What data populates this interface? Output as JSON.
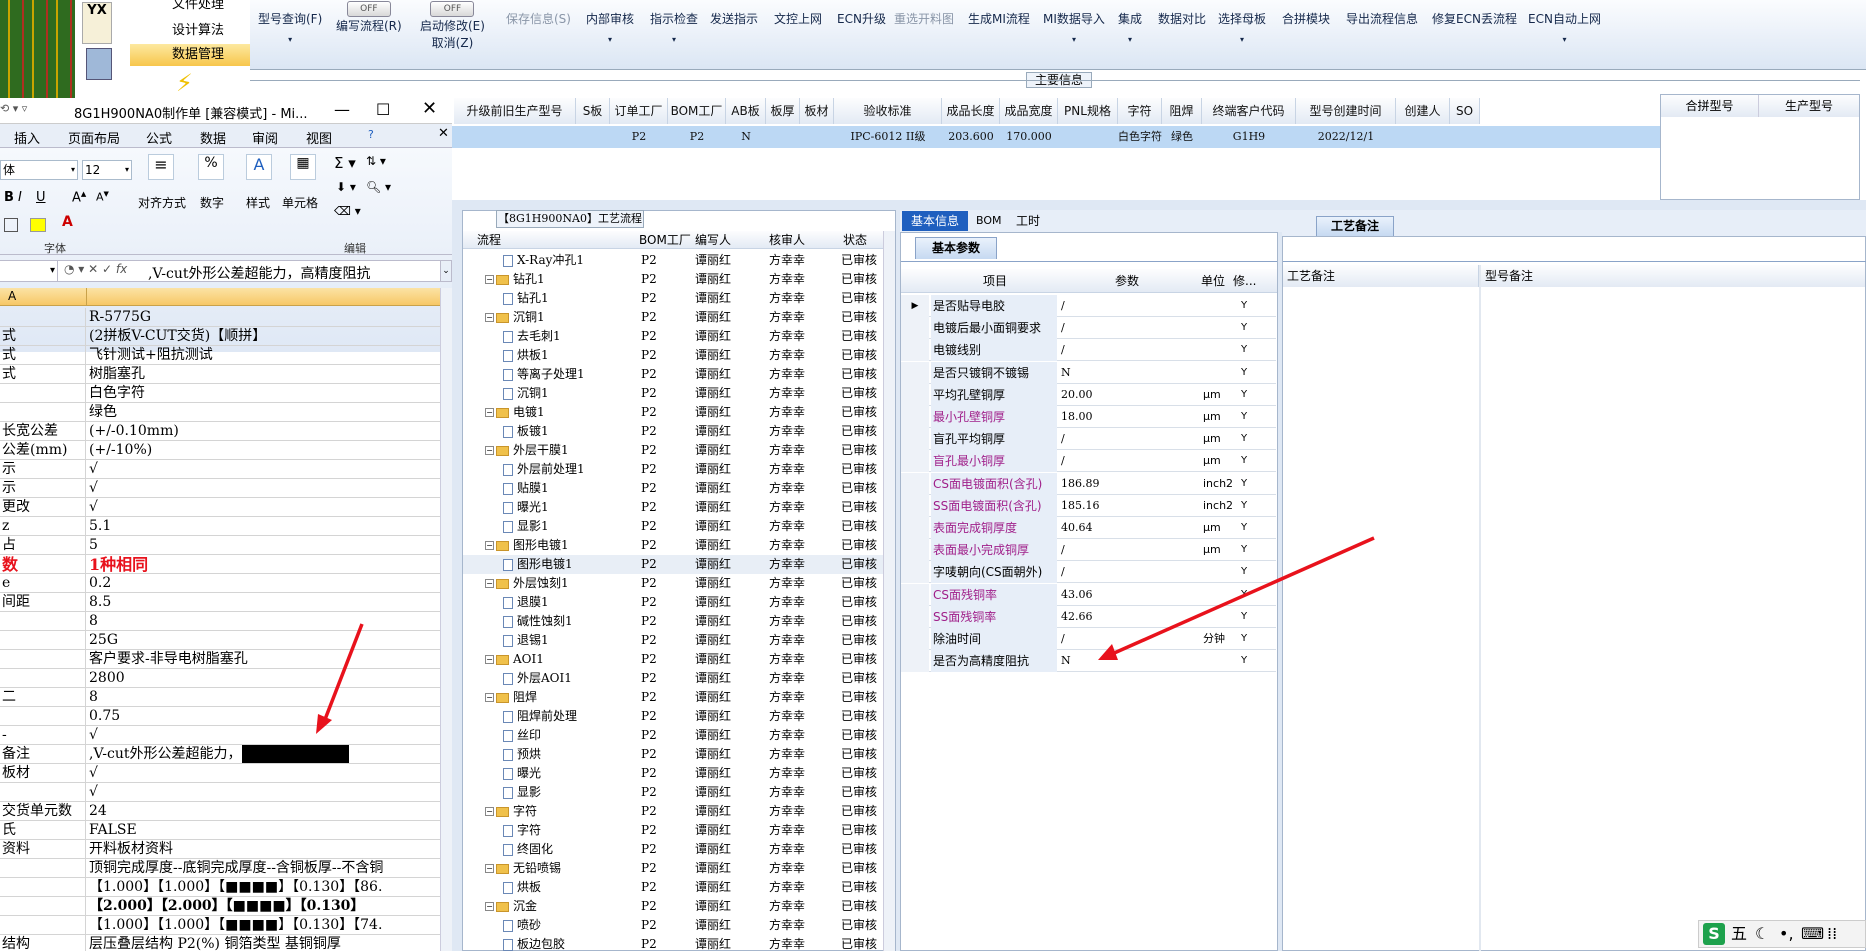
{
  "nav": {
    "items": [
      "文件处理",
      "设计算法",
      "数据管理"
    ],
    "logo": "YX"
  },
  "toolbar": {
    "items": [
      {
        "label": "型号查询(F)",
        "enabled": true
      },
      {
        "label": "编写流程(R)",
        "enabled": true
      },
      {
        "label": "启动修改(E)",
        "enabled": true
      },
      {
        "label": "取消(Z)",
        "enabled": true
      },
      {
        "label": "保存信息(S)",
        "enabled": false
      },
      {
        "label": "内部审核",
        "enabled": true
      },
      {
        "label": "指示检查",
        "enabled": true
      },
      {
        "label": "发送指示",
        "enabled": true
      },
      {
        "label": "文控上网",
        "enabled": true
      },
      {
        "label": "ECN升级",
        "enabled": true
      },
      {
        "label": "重选开料图",
        "enabled": false
      },
      {
        "label": "生成MI流程",
        "enabled": true
      },
      {
        "label": "MI数据导入",
        "enabled": true
      },
      {
        "label": "集成",
        "enabled": true
      },
      {
        "label": "数据对比",
        "enabled": true
      },
      {
        "label": "选择母板",
        "enabled": true
      },
      {
        "label": "合拼模块",
        "enabled": true
      },
      {
        "label": "导出流程信息",
        "enabled": true
      },
      {
        "label": "修复ECN丢流程",
        "enabled": true
      },
      {
        "label": "ECN自动上网",
        "enabled": true
      }
    ],
    "toggle_text": "OFF"
  },
  "main_info": {
    "title": "主要信息",
    "headers": [
      "升级前旧生产型号",
      "S板",
      "订单工厂",
      "BOM工厂",
      "AB板",
      "板厚",
      "板材",
      "验收标准",
      "成品长度",
      "成品宽度",
      "PNL规格",
      "字符",
      "阻焊",
      "终端客户代码",
      "型号创建时间",
      "创建人",
      "SO"
    ],
    "values": [
      "",
      "",
      "P2",
      "P2",
      "N",
      "",
      "",
      "IPC-6012 II级",
      "203.600",
      "170.000",
      "",
      "白色字符",
      "绿色",
      "G1H9",
      "2022/12/1",
      "",
      ""
    ],
    "side_headers": [
      "合拼型号",
      "生产型号"
    ]
  },
  "excel": {
    "title": "8G1H900NA0制作单 [兼容模式] - Mi...",
    "menu": [
      "插入",
      "页面布局",
      "公式",
      "数据",
      "审阅",
      "视图"
    ],
    "font_name": "体",
    "font_size": "12",
    "group_labels": [
      "对齐方式",
      "数字",
      "样式",
      "单元格"
    ],
    "section_labels": [
      "字体",
      "编辑"
    ],
    "formula": ",V-cut外形公差超能力，高精度阻抗",
    "col_a": "A",
    "rows": [
      {
        "a": "",
        "b": "R-5775G",
        "style": ""
      },
      {
        "a": "式",
        "b": "(2拼板V-CUT交货)【顺拼】",
        "style": ""
      },
      {
        "a": "式",
        "b": "飞针测试+阻抗测试",
        "style": ""
      },
      {
        "a": "式",
        "b": "树脂塞孔",
        "style": ""
      },
      {
        "a": "",
        "b": "白色字符",
        "style": ""
      },
      {
        "a": "",
        "b": "绿色",
        "style": ""
      },
      {
        "a": "长宽公差",
        "b": "(+/-0.10mm)",
        "style": ""
      },
      {
        "a": "公差(mm)",
        "b": "(+/-10%)",
        "style": ""
      },
      {
        "a": "示",
        "b": "√",
        "style": ""
      },
      {
        "a": "示",
        "b": "√",
        "style": ""
      },
      {
        "a": "更改",
        "b": "√",
        "style": ""
      },
      {
        "a": "z",
        "b": "5.1",
        "style": ""
      },
      {
        "a": "占",
        "b": "5",
        "style": ""
      },
      {
        "a": "数",
        "b": "1种相同",
        "style": "red"
      },
      {
        "a": "e",
        "b": "0.2",
        "style": ""
      },
      {
        "a": "间距",
        "b": "8.5",
        "style": ""
      },
      {
        "a": "",
        "b": "8",
        "style": ""
      },
      {
        "a": "",
        "b": "25G",
        "style": ""
      },
      {
        "a": "",
        "b": "客户要求-非导电树脂塞孔",
        "style": ""
      },
      {
        "a": "",
        "b": "2800",
        "style": ""
      },
      {
        "a": "二",
        "b": "8",
        "style": ""
      },
      {
        "a": "",
        "b": "0.75",
        "style": ""
      },
      {
        "a": "-",
        "b": "√",
        "style": ""
      },
      {
        "a": "备注",
        "b": ",V-cut外形公差超能力，高精度阻抗",
        "style": "sel"
      },
      {
        "a": "板材",
        "b": "√",
        "style": ""
      },
      {
        "a": "",
        "b": "√",
        "style": ""
      },
      {
        "a": "交货单元数",
        "b": "24",
        "style": ""
      },
      {
        "a": "氏",
        "b": "FALSE",
        "style": ""
      },
      {
        "a": "资料",
        "b": "开料板材资料",
        "style": ""
      },
      {
        "a": "",
        "b": "顶铜完成厚度--底铜完成厚度--含铜板厚--不含铜",
        "style": ""
      },
      {
        "a": "",
        "b": "【1.000】【1.000】【■■■■】【0.130】【86.",
        "style": ""
      },
      {
        "a": "",
        "b": "【2.000】【2.000】【■■■■】【0.130】",
        "style": "red2"
      },
      {
        "a": "",
        "b": "【1.000】【1.000】【■■■■】【0.130】【74.",
        "style": ""
      },
      {
        "a": "结构",
        "b": "层压叠层结构 P2(%) 铜箔类型 基铜铜厚",
        "style": ""
      }
    ]
  },
  "process": {
    "title": "【8G1H900NA0】工艺流程",
    "headers": [
      "流程",
      "BOM工厂",
      "编写人",
      "核审人",
      "状态"
    ],
    "rows": [
      {
        "n": "X-Ray冲孔1",
        "lvl": 2,
        "t": "doc",
        "f": "P2",
        "w": "谭丽红",
        "r": "方幸幸",
        "s": "已审核"
      },
      {
        "n": "钻孔1",
        "lvl": 1,
        "t": "folder",
        "f": "P2",
        "w": "谭丽红",
        "r": "方幸幸",
        "s": "已审核"
      },
      {
        "n": "钻孔1",
        "lvl": 2,
        "t": "doc",
        "f": "P2",
        "w": "谭丽红",
        "r": "方幸幸",
        "s": "已审核"
      },
      {
        "n": "沉铜1",
        "lvl": 1,
        "t": "folder",
        "f": "P2",
        "w": "谭丽红",
        "r": "方幸幸",
        "s": "已审核"
      },
      {
        "n": "去毛刺1",
        "lvl": 2,
        "t": "doc",
        "f": "P2",
        "w": "谭丽红",
        "r": "方幸幸",
        "s": "已审核"
      },
      {
        "n": "烘板1",
        "lvl": 2,
        "t": "doc",
        "f": "P2",
        "w": "谭丽红",
        "r": "方幸幸",
        "s": "已审核"
      },
      {
        "n": "等离子处理1",
        "lvl": 2,
        "t": "doc",
        "f": "P2",
        "w": "谭丽红",
        "r": "方幸幸",
        "s": "已审核"
      },
      {
        "n": "沉铜1",
        "lvl": 2,
        "t": "doc",
        "f": "P2",
        "w": "谭丽红",
        "r": "方幸幸",
        "s": "已审核"
      },
      {
        "n": "电镀1",
        "lvl": 1,
        "t": "folder",
        "f": "P2",
        "w": "谭丽红",
        "r": "方幸幸",
        "s": "已审核"
      },
      {
        "n": "板镀1",
        "lvl": 2,
        "t": "doc",
        "f": "P2",
        "w": "谭丽红",
        "r": "方幸幸",
        "s": "已审核"
      },
      {
        "n": "外层干膜1",
        "lvl": 1,
        "t": "folder",
        "f": "P2",
        "w": "谭丽红",
        "r": "方幸幸",
        "s": "已审核"
      },
      {
        "n": "外层前处理1",
        "lvl": 2,
        "t": "doc",
        "f": "P2",
        "w": "谭丽红",
        "r": "方幸幸",
        "s": "已审核"
      },
      {
        "n": "贴膜1",
        "lvl": 2,
        "t": "doc",
        "f": "P2",
        "w": "谭丽红",
        "r": "方幸幸",
        "s": "已审核"
      },
      {
        "n": "曝光1",
        "lvl": 2,
        "t": "doc",
        "f": "P2",
        "w": "谭丽红",
        "r": "方幸幸",
        "s": "已审核"
      },
      {
        "n": "显影1",
        "lvl": 2,
        "t": "doc",
        "f": "P2",
        "w": "谭丽红",
        "r": "方幸幸",
        "s": "已审核"
      },
      {
        "n": "图形电镀1",
        "lvl": 1,
        "t": "folder",
        "f": "P2",
        "w": "谭丽红",
        "r": "方幸幸",
        "s": "已审核"
      },
      {
        "n": "图形电镀1",
        "lvl": 2,
        "t": "doc",
        "f": "P2",
        "w": "谭丽红",
        "r": "方幸幸",
        "s": "已审核"
      },
      {
        "n": "外层蚀刻1",
        "lvl": 1,
        "t": "folder",
        "f": "P2",
        "w": "谭丽红",
        "r": "方幸幸",
        "s": "已审核"
      },
      {
        "n": "退膜1",
        "lvl": 2,
        "t": "doc",
        "f": "P2",
        "w": "谭丽红",
        "r": "方幸幸",
        "s": "已审核"
      },
      {
        "n": "碱性蚀刻1",
        "lvl": 2,
        "t": "doc",
        "f": "P2",
        "w": "谭丽红",
        "r": "方幸幸",
        "s": "已审核"
      },
      {
        "n": "退锡1",
        "lvl": 2,
        "t": "doc",
        "f": "P2",
        "w": "谭丽红",
        "r": "方幸幸",
        "s": "已审核"
      },
      {
        "n": "AOI1",
        "lvl": 1,
        "t": "folder",
        "f": "P2",
        "w": "谭丽红",
        "r": "方幸幸",
        "s": "已审核"
      },
      {
        "n": "外层AOI1",
        "lvl": 2,
        "t": "doc",
        "f": "P2",
        "w": "谭丽红",
        "r": "方幸幸",
        "s": "已审核"
      },
      {
        "n": "阻焊",
        "lvl": 1,
        "t": "folder",
        "f": "P2",
        "w": "谭丽红",
        "r": "方幸幸",
        "s": "已审核"
      },
      {
        "n": "阻焊前处理",
        "lvl": 2,
        "t": "doc",
        "f": "P2",
        "w": "谭丽红",
        "r": "方幸幸",
        "s": "已审核"
      },
      {
        "n": "丝印",
        "lvl": 2,
        "t": "doc",
        "f": "P2",
        "w": "谭丽红",
        "r": "方幸幸",
        "s": "已审核"
      },
      {
        "n": "预烘",
        "lvl": 2,
        "t": "doc",
        "f": "P2",
        "w": "谭丽红",
        "r": "方幸幸",
        "s": "已审核"
      },
      {
        "n": "曝光",
        "lvl": 2,
        "t": "doc",
        "f": "P2",
        "w": "谭丽红",
        "r": "方幸幸",
        "s": "已审核"
      },
      {
        "n": "显影",
        "lvl": 2,
        "t": "doc",
        "f": "P2",
        "w": "谭丽红",
        "r": "方幸幸",
        "s": "已审核"
      },
      {
        "n": "字符",
        "lvl": 1,
        "t": "folder",
        "f": "P2",
        "w": "谭丽红",
        "r": "方幸幸",
        "s": "已审核"
      },
      {
        "n": "字符",
        "lvl": 2,
        "t": "doc",
        "f": "P2",
        "w": "谭丽红",
        "r": "方幸幸",
        "s": "已审核"
      },
      {
        "n": "终固化",
        "lvl": 2,
        "t": "doc",
        "f": "P2",
        "w": "谭丽红",
        "r": "方幸幸",
        "s": "已审核"
      },
      {
        "n": "无铅喷锡",
        "lvl": 1,
        "t": "folder",
        "f": "P2",
        "w": "谭丽红",
        "r": "方幸幸",
        "s": "已审核"
      },
      {
        "n": "烘板",
        "lvl": 2,
        "t": "doc",
        "f": "P2",
        "w": "谭丽红",
        "r": "方幸幸",
        "s": "已审核"
      },
      {
        "n": "沉金",
        "lvl": 1,
        "t": "folder",
        "f": "P2",
        "w": "谭丽红",
        "r": "方幸幸",
        "s": "已审核"
      },
      {
        "n": "喷砂",
        "lvl": 2,
        "t": "doc",
        "f": "P2",
        "w": "谭丽红",
        "r": "方幸幸",
        "s": "已审核"
      },
      {
        "n": "板边包胶",
        "lvl": 2,
        "t": "doc",
        "f": "P2",
        "w": "谭丽红",
        "r": "方幸幸",
        "s": "已审核"
      }
    ]
  },
  "basic": {
    "tabs": [
      "基本信息",
      "BOM",
      "工时"
    ],
    "subtab": "基本参数",
    "headers": [
      "项目",
      "参数",
      "单位",
      "修..."
    ],
    "rows": [
      {
        "item": "是否贴导电胶",
        "param": "/",
        "unit": "",
        "flag": "Y",
        "color": "#000"
      },
      {
        "item": "电镀后最小面铜要求",
        "param": "/",
        "unit": "",
        "flag": "Y",
        "color": "#000"
      },
      {
        "item": "电镀线别",
        "param": "/",
        "unit": "",
        "flag": "Y",
        "color": "#000"
      },
      {
        "item": "是否只镀铜不镀锡",
        "param": "N",
        "unit": "",
        "flag": "Y",
        "color": "#000"
      },
      {
        "item": "平均孔壁铜厚",
        "param": "20.00",
        "unit": "μm",
        "flag": "Y",
        "color": "#000"
      },
      {
        "item": "最小孔壁铜厚",
        "param": "18.00",
        "unit": "μm",
        "flag": "Y",
        "color": "#a0208a"
      },
      {
        "item": "盲孔平均铜厚",
        "param": "/",
        "unit": "μm",
        "flag": "Y",
        "color": "#000"
      },
      {
        "item": "盲孔最小铜厚",
        "param": "/",
        "unit": "μm",
        "flag": "Y",
        "color": "#a0208a"
      },
      {
        "item": "CS面电镀面积(含孔)",
        "param": "186.89",
        "unit": "inch2",
        "flag": "Y",
        "color": "#a0208a"
      },
      {
        "item": "SS面电镀面积(含孔)",
        "param": "185.16",
        "unit": "inch2",
        "flag": "Y",
        "color": "#a0208a"
      },
      {
        "item": "表面完成铜厚度",
        "param": "40.64",
        "unit": "μm",
        "flag": "Y",
        "color": "#a0208a"
      },
      {
        "item": "表面最小完成铜厚",
        "param": "/",
        "unit": "μm",
        "flag": "Y",
        "color": "#a0208a"
      },
      {
        "item": "字唛朝向(CS面朝外)",
        "param": "/",
        "unit": "",
        "flag": "Y",
        "color": "#000"
      },
      {
        "item": "CS面残铜率",
        "param": "43.06",
        "unit": "",
        "flag": "Y",
        "color": "#a0208a"
      },
      {
        "item": "SS面残铜率",
        "param": "42.66",
        "unit": "",
        "flag": "Y",
        "color": "#a0208a"
      },
      {
        "item": "除油时间",
        "param": "/",
        "unit": "分钟",
        "flag": "Y",
        "color": "#000"
      },
      {
        "item": "是否为高精度阻抗",
        "param": "N",
        "unit": "",
        "flag": "Y",
        "color": "#000"
      }
    ]
  },
  "remarks": {
    "tab": "工艺备注",
    "headers": [
      "工艺备注",
      "型号备注"
    ]
  },
  "tray": {
    "ime": "五",
    "icons": [
      "moon-icon",
      "dot-icon",
      "keyboard-icon",
      "grid-icon"
    ]
  },
  "colors": {
    "accent": "#1f5fbf",
    "annotation": "#e8121c",
    "selection": "#bcd8f4"
  }
}
